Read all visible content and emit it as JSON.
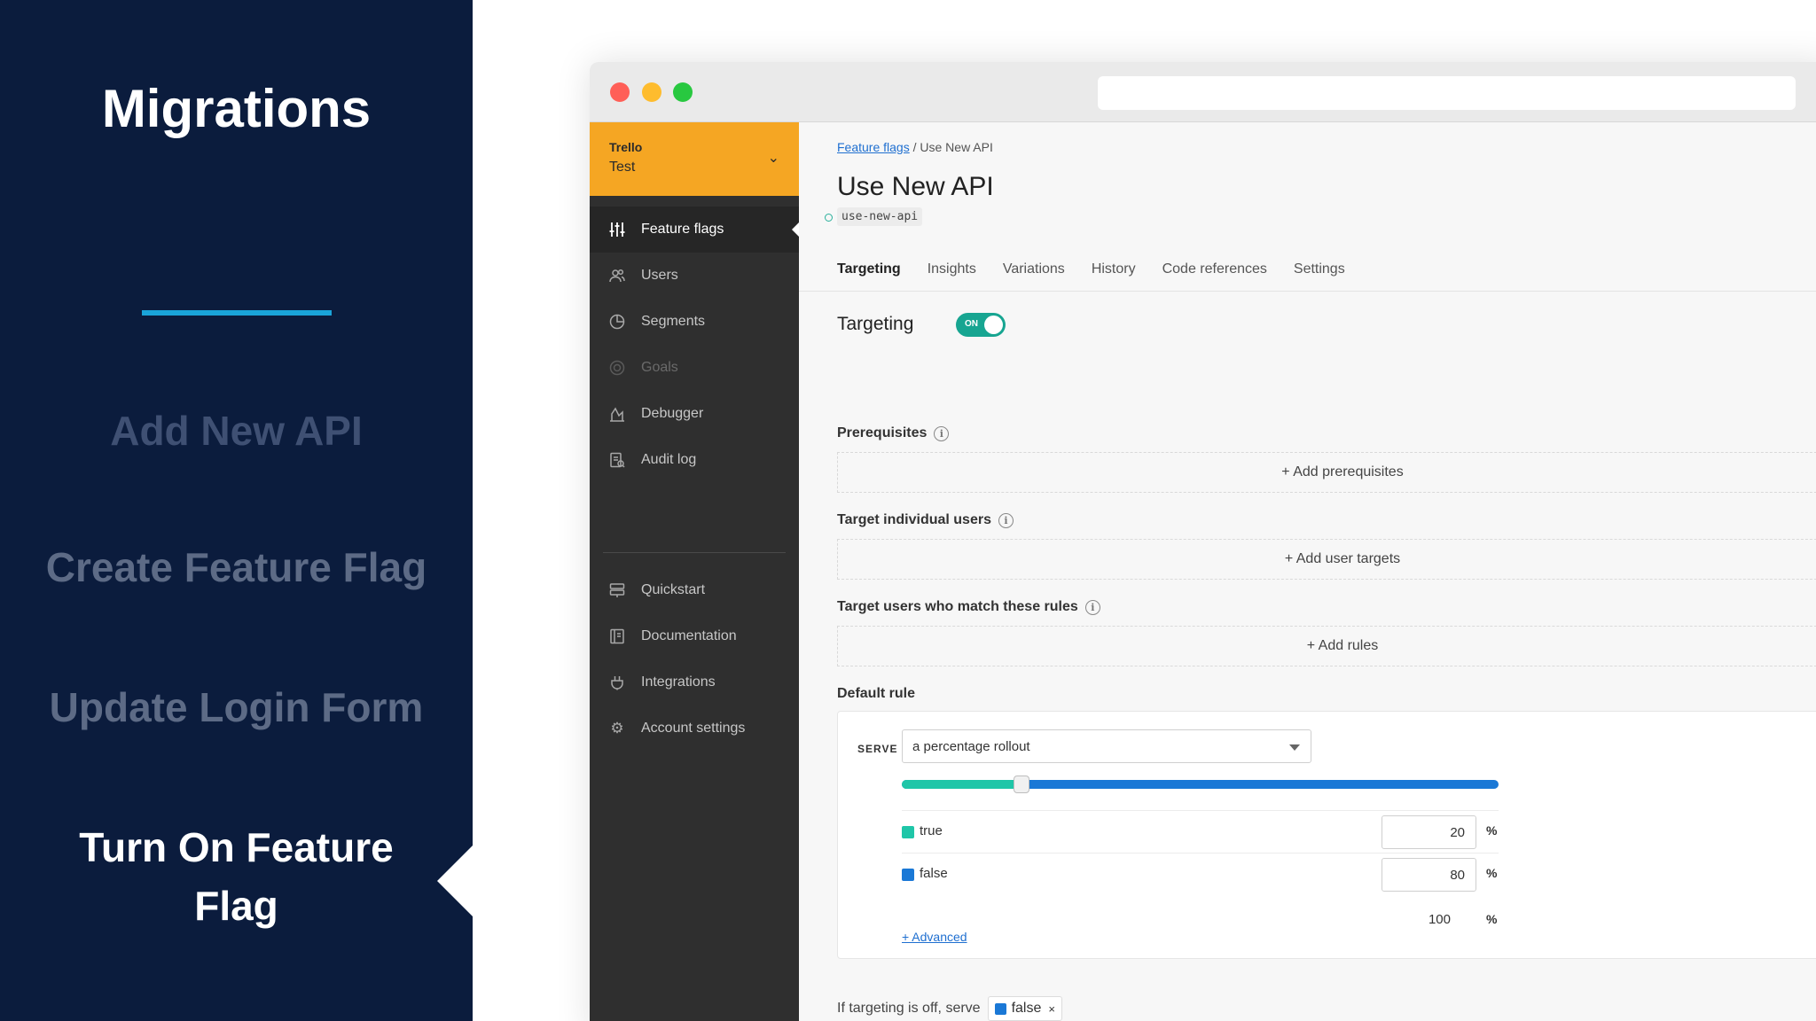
{
  "slide": {
    "title": "Migrations",
    "agenda": [
      "Add New API",
      "Create Feature Flag",
      "Update Login Form",
      "Turn On Feature Flag"
    ],
    "active_index": 3,
    "accent_color": "#1aa4d9",
    "background_color": "#0b1c3d"
  },
  "sidebar": {
    "project_name": "Trello",
    "environment": "Test",
    "project_color": "#f5a623",
    "items": [
      {
        "label": "Feature flags",
        "icon": "sliders-icon"
      },
      {
        "label": "Users",
        "icon": "users-icon"
      },
      {
        "label": "Segments",
        "icon": "pie-chart-icon"
      },
      {
        "label": "Goals",
        "icon": "target-icon"
      },
      {
        "label": "Debugger",
        "icon": "debugger-icon"
      },
      {
        "label": "Audit log",
        "icon": "audit-log-icon"
      }
    ],
    "secondary_items": [
      {
        "label": "Quickstart",
        "icon": "quickstart-icon"
      },
      {
        "label": "Documentation",
        "icon": "book-icon"
      },
      {
        "label": "Integrations",
        "icon": "plug-icon"
      },
      {
        "label": "Account settings",
        "icon": "gear-icon"
      }
    ]
  },
  "breadcrumb": {
    "parent": "Feature flags",
    "separator": "/",
    "current": "Use New API"
  },
  "flag": {
    "name": "Use New API",
    "key": "use-new-api"
  },
  "tabs": [
    "Targeting",
    "Insights",
    "Variations",
    "History",
    "Code references",
    "Settings"
  ],
  "targeting": {
    "label": "Targeting",
    "toggle_text": "ON",
    "enabled": true,
    "toggle_color": "#17a591",
    "prerequisites_label": "Prerequisites",
    "add_prerequisites": "+ Add prerequisites",
    "individual_label": "Target individual users",
    "add_user_targets": "+ Add user targets",
    "rules_label": "Target users who match these rules",
    "add_rules": "+ Add rules"
  },
  "default_rule": {
    "label": "Default rule",
    "serve_label": "SERVE",
    "serve_value": "a percentage rollout",
    "variations": [
      {
        "name": "true",
        "percent": "20",
        "color": "#1fc6a8"
      },
      {
        "name": "false",
        "percent": "80",
        "color": "#1a78d6"
      }
    ],
    "percent_sign": "%",
    "total": "100",
    "advanced_link": "+ Advanced"
  },
  "off_variation": {
    "label": "If targeting is off, serve",
    "value": "false",
    "color": "#1a78d6",
    "remove": "×"
  }
}
